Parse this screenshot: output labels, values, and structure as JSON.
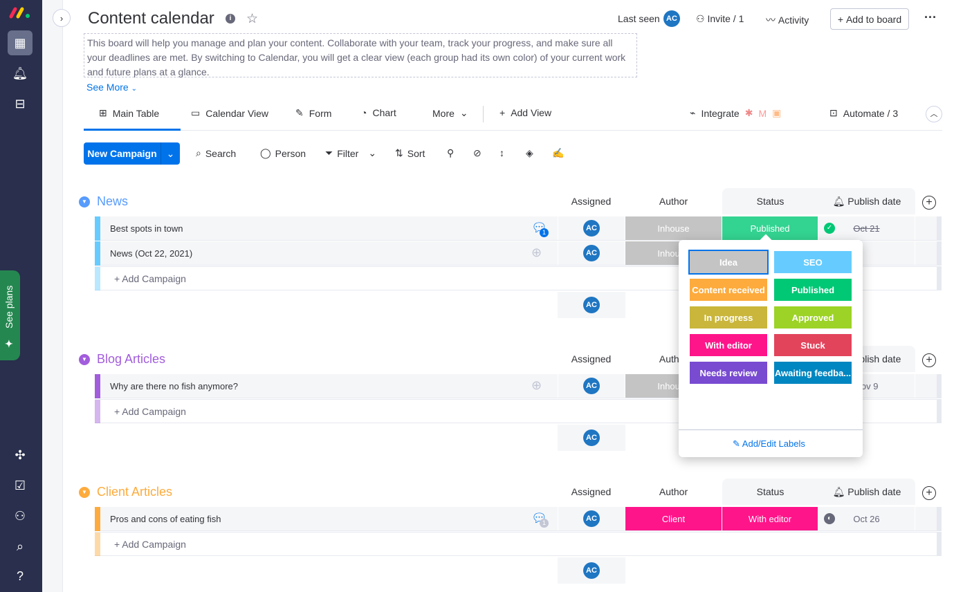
{
  "nav": {
    "icons": [
      "monday-logo",
      "apps-grid-icon",
      "bell-icon",
      "inbox-icon",
      "puzzle-icon",
      "calendar-check-icon",
      "invite-user-icon",
      "search-icon",
      "help-icon"
    ],
    "see_plans": "See plans"
  },
  "header": {
    "title": "Content calendar",
    "description": "This board will help you manage and plan your content. Collaborate with your team, track your progress, and make sure all your deadlines are met. By switching to Calendar, you will get a clear view (each group had its own color) of your current work and future plans at a glance.",
    "see_more": "See More",
    "last_seen": "Last seen",
    "avatar": "AC",
    "invite": "Invite / 1",
    "activity": "Activity",
    "add_to_board": "Add to board"
  },
  "tabs": [
    {
      "label": "Main Table"
    },
    {
      "label": "Calendar View"
    },
    {
      "label": "Form"
    },
    {
      "label": "Chart"
    },
    {
      "label": "More"
    }
  ],
  "add_view": "Add View",
  "integrate": "Integrate",
  "automate": "Automate / 3",
  "toolbar": {
    "new_item": "New Campaign",
    "search": "Search",
    "person": "Person",
    "filter": "Filter",
    "sort": "Sort"
  },
  "columns": {
    "assigned": "Assigned",
    "author": "Author",
    "status": "Status",
    "publish_date": "Publish date"
  },
  "add_item": "+ Add Campaign",
  "groups": [
    {
      "name": "News",
      "color": "#579bfc",
      "light": "#66ccff",
      "items": [
        {
          "name": "Best spots in town",
          "updates": "1",
          "assigned": "AC",
          "author": "Inhouse",
          "status": "Published",
          "status_color": "#33d391",
          "date": "Oct 21",
          "date_done": true
        },
        {
          "name": "News (Oct 22, 2021)",
          "updates": "",
          "assigned": "AC",
          "author": "Inhouse",
          "status": "",
          "status_color": "",
          "date": ""
        }
      ]
    },
    {
      "name": "Blog Articles",
      "color": "#a25ddc",
      "light": "#a25ddc",
      "items": [
        {
          "name": "Why are there no fish anymore?",
          "updates": "",
          "assigned": "AC",
          "author": "Inhouse",
          "status": "",
          "status_color": "",
          "date": "Nov 9"
        }
      ]
    },
    {
      "name": "Client Articles",
      "color": "#fdab3d",
      "light": "#fdab3d",
      "items": [
        {
          "name": "Pros and cons of eating fish",
          "updates": "1",
          "assigned": "AC",
          "author": "Client",
          "author_color": "#ff158a",
          "status": "With editor",
          "status_color": "#ff158a",
          "date": "Oct 26"
        }
      ]
    }
  ],
  "status_labels": [
    {
      "label": "Idea",
      "color": "#c4c4c4",
      "selected": true
    },
    {
      "label": "SEO",
      "color": "#66ccff"
    },
    {
      "label": "Content received",
      "color": "#fdab3d"
    },
    {
      "label": "Published",
      "color": "#00c875"
    },
    {
      "label": "In progress",
      "color": "#c9b63b"
    },
    {
      "label": "Approved",
      "color": "#9cd326"
    },
    {
      "label": "With editor",
      "color": "#ff158a"
    },
    {
      "label": "Stuck",
      "color": "#e2445c"
    },
    {
      "label": "Needs review",
      "color": "#784bd1"
    },
    {
      "label": "Awaiting feedba...",
      "color": "#0086c0"
    }
  ],
  "edit_labels": "Add/Edit Labels"
}
